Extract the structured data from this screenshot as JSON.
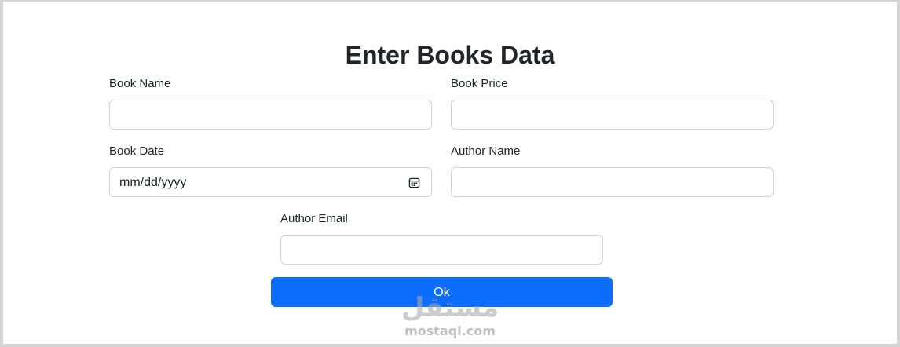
{
  "form": {
    "title": "Enter Books Data",
    "fields": {
      "book_name": {
        "label": "Book Name",
        "value": ""
      },
      "book_price": {
        "label": "Book Price",
        "value": ""
      },
      "book_date": {
        "label": "Book Date",
        "placeholder": "mm/dd/yyyy",
        "icon": "calendar-icon"
      },
      "author_name": {
        "label": "Author Name",
        "value": ""
      },
      "author_email": {
        "label": "Author Email",
        "value": ""
      }
    },
    "submit_label": "Ok",
    "submit_color": "#0d6efd"
  },
  "watermark": {
    "logo_text": "مستقل",
    "url": "mostaql.com"
  }
}
